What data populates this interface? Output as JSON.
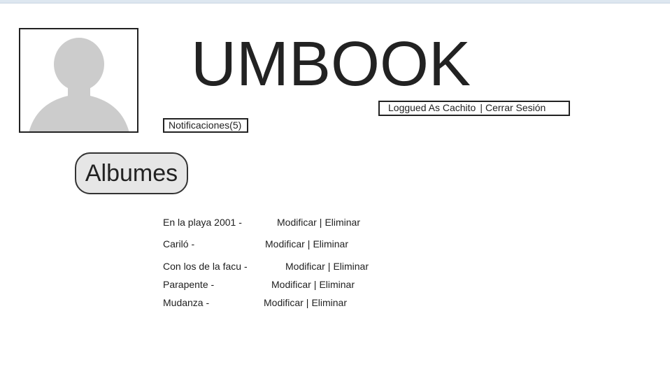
{
  "header": {
    "title": "UMBOOK",
    "avatar_icon": "user-silhouette-icon"
  },
  "session": {
    "logged_as": "Loggued As Cachito",
    "separator": "|",
    "logout": "Cerrar Sesión"
  },
  "notifications": {
    "label": "Notificaciones(5)"
  },
  "albums_button": {
    "label": "Albumes"
  },
  "albums": [
    {
      "name": "En la playa 2001 -",
      "modify": "Modificar",
      "separator": "|",
      "delete": "Eliminar"
    },
    {
      "name": "Cariló -",
      "modify": "Modificar",
      "separator": "|",
      "delete": "Eliminar"
    },
    {
      "name": "Con los de la facu -",
      "modify": "Modificar",
      "separator": "|",
      "delete": "Eliminar"
    },
    {
      "name": "Parapente -",
      "modify": "Modificar",
      "separator": "|",
      "delete": "Eliminar"
    },
    {
      "name": "Mudanza -",
      "modify": "Modificar",
      "separator": "|",
      "delete": "Eliminar"
    }
  ]
}
